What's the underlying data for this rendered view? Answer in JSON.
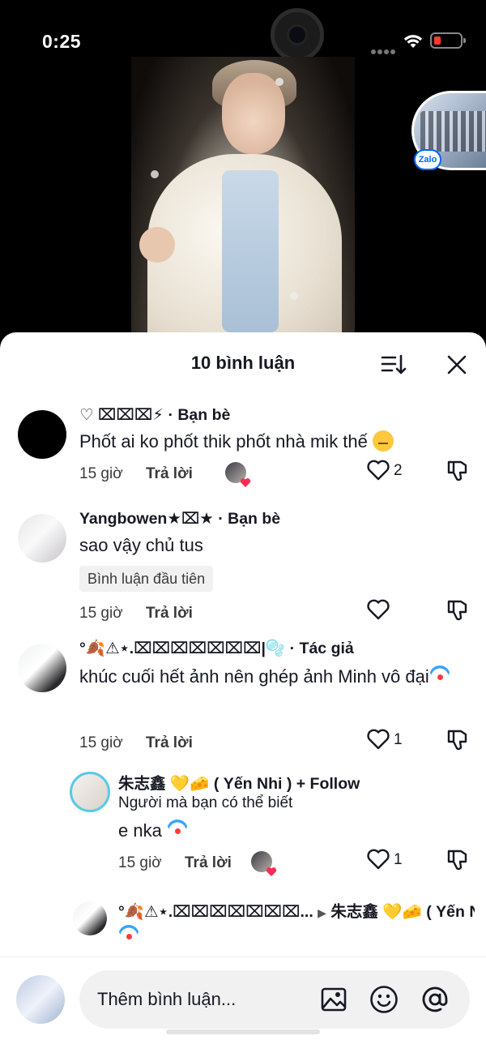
{
  "status_bar": {
    "time": "0:25"
  },
  "overlay": {
    "zalo_badge": "Zalo"
  },
  "sheet": {
    "title": "10 bình luận"
  },
  "comments": [
    {
      "author": "♡ ⌧⌧⌧⚡",
      "relation": "· Bạn bè",
      "text": "Phốt ai ko phốt thik phốt nhà mik thế",
      "time": "15 giờ",
      "reply": "Trả lời",
      "likes": "2"
    },
    {
      "author": "Yangbowen★⌧★",
      "relation": "· Bạn bè",
      "text": "sao vậy chủ tus",
      "badge": "Bình luận đầu tiên",
      "time": "15 giờ",
      "reply": "Trả lời",
      "likes": ""
    },
    {
      "author": "°🍂⚠⋆.⌧⌧⌧⌧⌧⌧⌧|🫧",
      "relation": "· Tác giả",
      "text": "khúc cuối hết ảnh nên ghép ảnh Minh vô đại",
      "time": "15 giờ",
      "reply": "Trả lời",
      "likes": "1"
    },
    {
      "author": "朱志鑫 💛🧀 ( Yến Nhi )",
      "follow": "+ Follow",
      "subtitle": "Người mà bạn có thể biết",
      "text": "e nka",
      "time": "15 giờ",
      "reply": "Trả lời",
      "likes": "1"
    },
    {
      "author": "°🍂⚠⋆.⌧⌧⌧⌧⌧⌧⌧...",
      "reply_to": "朱志鑫 💛🧀 ( Yến N..."
    }
  ],
  "input": {
    "placeholder": "Thêm bình luận..."
  },
  "colors": {
    "accent_red": "#fe2c55",
    "text": "#161823",
    "badge_bg": "#f1f1f2"
  }
}
